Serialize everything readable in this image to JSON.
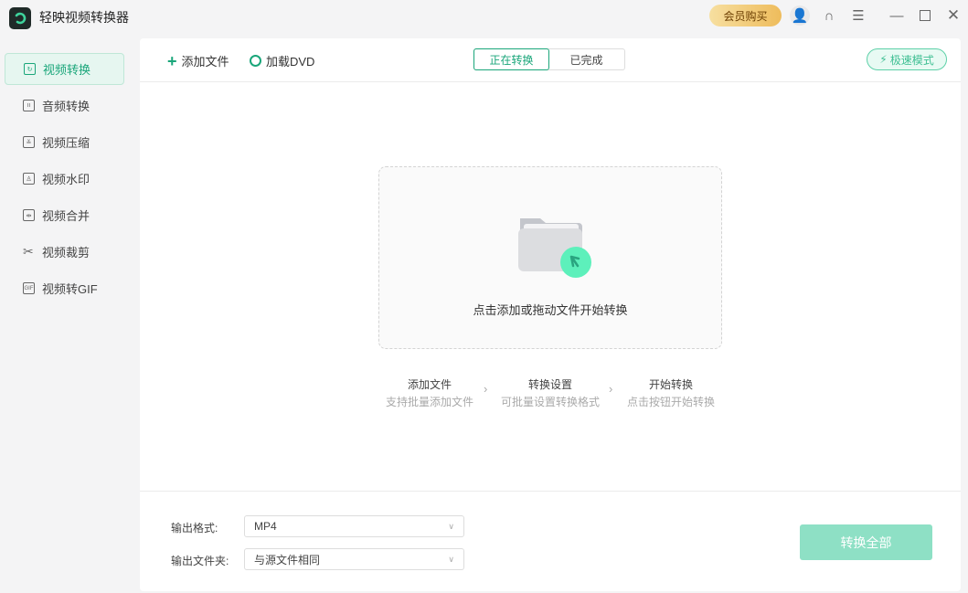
{
  "app": {
    "title": "轻映视频转换器",
    "vip_label": "会员购买"
  },
  "sidebar": {
    "items": [
      {
        "label": "视频转换",
        "icon": "refresh-icon",
        "active": true
      },
      {
        "label": "音频转换",
        "icon": "audio-icon"
      },
      {
        "label": "视频压缩",
        "icon": "compress-icon"
      },
      {
        "label": "视频水印",
        "icon": "watermark-icon"
      },
      {
        "label": "视频合并",
        "icon": "merge-icon"
      },
      {
        "label": "视频裁剪",
        "icon": "scissors-icon"
      },
      {
        "label": "视频转GIF",
        "icon": "gif-icon"
      }
    ]
  },
  "toolbar": {
    "add_file": "添加文件",
    "load_dvd": "加载DVD",
    "tabs": [
      "正在转换",
      "已完成"
    ],
    "fast_mode": "极速模式"
  },
  "drop": {
    "text": "点击添加或拖动文件开始转换"
  },
  "steps": [
    {
      "title": "添加文件",
      "desc": "支持批量添加文件"
    },
    {
      "title": "转换设置",
      "desc": "可批量设置转换格式"
    },
    {
      "title": "开始转换",
      "desc": "点击按钮开始转换"
    }
  ],
  "output": {
    "format_label": "输出格式:",
    "format_value": "MP4",
    "folder_label": "输出文件夹:",
    "folder_value": "与源文件相同"
  },
  "convert_all": "转换全部",
  "colors": {
    "accent": "#1aa67a",
    "convert_disabled": "#8ee0c5",
    "vip": "#eebc5c"
  }
}
